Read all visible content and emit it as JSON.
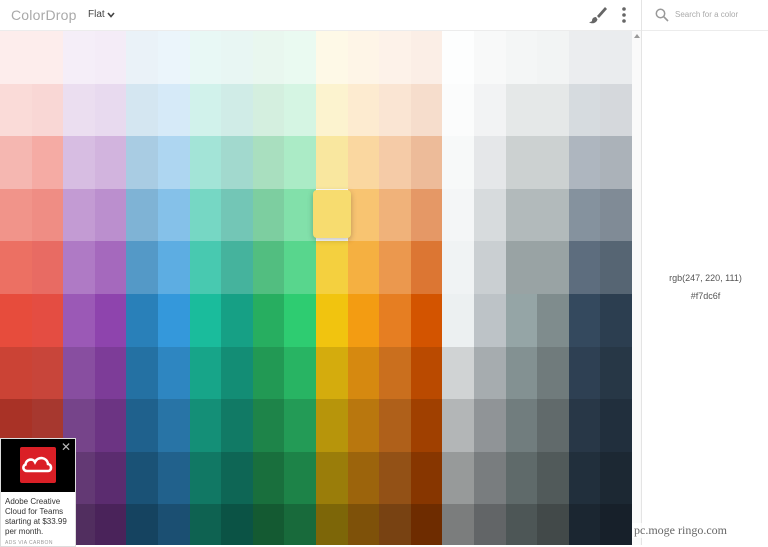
{
  "app": {
    "logo": "ColorDrop",
    "palette": "Flat"
  },
  "search": {
    "placeholder": "Search for a color",
    "value": ""
  },
  "selected": {
    "rgb": "rgb(247, 220, 111)",
    "hex": "#f7dc6f"
  },
  "ad": {
    "text": "Adobe Creative Cloud for Teams starting at $33.99 per month.",
    "brand": "ADS VIA CARBON",
    "close": "✕"
  },
  "watermark": "pc.moge ringo.com",
  "icons": {
    "search": "search-icon",
    "brush": "paintbrush-icon",
    "more": "more-vert-icon",
    "chevron": "chevron-down-icon",
    "ad_logo": "adobe-creative-cloud-logo"
  },
  "swatches": [
    [
      "#fdedec",
      "#fdedec",
      "#f5eef8",
      "#f4ecf7",
      "#eaf2f8",
      "#ebf5fb",
      "#e8f8f5",
      "#e8f6f3",
      "#e9f7ef",
      "#eafaf1",
      "#fef9e7",
      "#fef5e7",
      "#fdf2e9",
      "#fbeee6",
      "#fdfefe",
      "#f8f9f9",
      "#f4f6f6",
      "#f2f4f4",
      "#ebedef",
      "#eaecee"
    ],
    [
      "#fadbd8",
      "#f9d7d5",
      "#ebdef0",
      "#e8daef",
      "#d4e6f1",
      "#d6eaf8",
      "#d1f2eb",
      "#d0ece7",
      "#d4efdf",
      "#d5f5e3",
      "#fcf3cf",
      "#fdebd0",
      "#fae5d3",
      "#f6ddcc",
      "#fbfcfc",
      "#f2f3f4",
      "#e5e8e8",
      "#e5e8e8",
      "#d6dbdf",
      "#d5d8dc"
    ],
    [
      "#f5b7b1",
      "#f5aba4",
      "#d7bde2",
      "#d2b4de",
      "#a9cce3",
      "#aed6f1",
      "#a3e4d7",
      "#a2d9ce",
      "#a9dfbf",
      "#abebc6",
      "#f9e79f",
      "#fad7a0",
      "#f5cba7",
      "#edbb99",
      "#f7f9f9",
      "#e5e7e9",
      "#ccd1d1",
      "#ccd1d1",
      "#aeb6bf",
      "#abb2b9"
    ],
    [
      "#f1948a",
      "#ef8d84",
      "#c39bd3",
      "#bb8fce",
      "#7fb3d5",
      "#85c1e9",
      "#76d7c4",
      "#73c6b6",
      "#7dcea0",
      "#82e0aa",
      "#f7dc6f",
      "#f8c471",
      "#f0b27a",
      "#e59866",
      "#f4f6f7",
      "#d7dbdd",
      "#b2babb",
      "#b2babb",
      "#85929e",
      "#808b96"
    ],
    [
      "#ec7063",
      "#e86b63",
      "#af7ac5",
      "#a569bd",
      "#5499c7",
      "#5dade2",
      "#48c9b0",
      "#45b39d",
      "#52be80",
      "#58d68d",
      "#f4d03f",
      "#f5b041",
      "#eb984e",
      "#dc7633",
      "#f0f3f4",
      "#cacfd2",
      "#99a3a4",
      "#99a3a4",
      "#5d6d7e",
      "#566573"
    ],
    [
      "#e74c3c",
      "#e44d42",
      "#9b59b6",
      "#8e44ad",
      "#2980b9",
      "#3498db",
      "#1abc9c",
      "#16a085",
      "#27ae60",
      "#2ecc71",
      "#f1c40f",
      "#f39c12",
      "#e67e22",
      "#d35400",
      "#ecf0f1",
      "#bdc3c7",
      "#95a5a6",
      "#7f8c8d",
      "#34495e",
      "#2c3e50"
    ],
    [
      "#cb4335",
      "#c8453a",
      "#884ea0",
      "#7d3c98",
      "#2471a3",
      "#2e86c1",
      "#17a589",
      "#138d75",
      "#229954",
      "#28b463",
      "#d4ac0d",
      "#d68910",
      "#ca6f1e",
      "#ba4a00",
      "#d0d3d4",
      "#a6acaf",
      "#839192",
      "#707b7c",
      "#2e4053",
      "#273746"
    ],
    [
      "#a93226",
      "#a7382f",
      "#76448a",
      "#6c3483",
      "#1f618d",
      "#2874a6",
      "#148f77",
      "#117a65",
      "#1e8449",
      "#239b56",
      "#b7950b",
      "#b9770e",
      "#af601a",
      "#a04000",
      "#b3b6b7",
      "#909497",
      "#717d7e",
      "#616a6b",
      "#283747",
      "#212f3d"
    ],
    [
      "#922b21",
      "#8e2d26",
      "#633974",
      "#5b2c6f",
      "#1a5276",
      "#21618c",
      "#117864",
      "#0e6655",
      "#196f3d",
      "#1d8348",
      "#9a7d0a",
      "#9c640c",
      "#935116",
      "#873600",
      "#979a9a",
      "#797d7f",
      "#5f6a6a",
      "#515a5a",
      "#212f3c",
      "#1c2833"
    ],
    [
      "#78281f",
      "#742520",
      "#512e5f",
      "#4a235a",
      "#154360",
      "#1b4f72",
      "#0e6251",
      "#0b5345",
      "#145a32",
      "#186a3b",
      "#7d6608",
      "#7e5109",
      "#784212",
      "#6e2c00",
      "#7b7d7d",
      "#626567",
      "#4d5656",
      "#424949",
      "#1b2631",
      "#17202a"
    ]
  ]
}
